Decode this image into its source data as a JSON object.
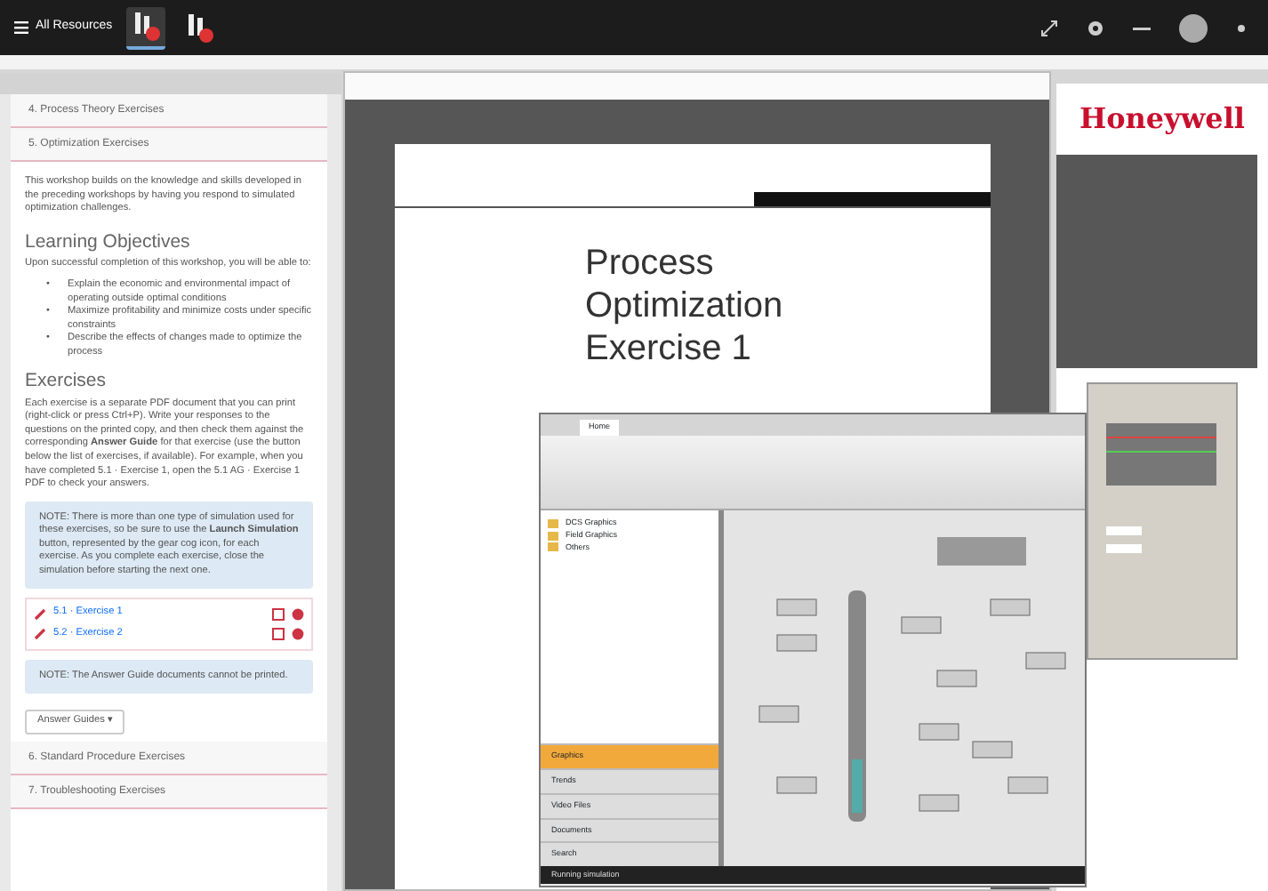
{
  "taskbar": {
    "menu_label": "All Resources",
    "app_icons": [
      {
        "selected": true
      },
      {
        "selected": false
      }
    ]
  },
  "course_panel": {
    "sections": [
      {
        "label": "4. Process Theory Exercises"
      },
      {
        "label": "5. Optimization Exercises"
      }
    ],
    "intro": "This workshop builds on the knowledge and skills developed in the preceding workshops by having you respond to simulated optimization challenges.",
    "objectives_heading": "Learning Objectives",
    "objectives_intro": "Upon successful completion of this workshop, you will be able to:",
    "objectives": [
      {
        "bullet": "•",
        "text": "Explain the economic and environmental impact of operating outside optimal conditions"
      },
      {
        "bullet": "•",
        "text": "Maximize profitability and minimize costs under specific constraints"
      },
      {
        "bullet": "•",
        "text": "Describe the effects of changes made to optimize the process"
      }
    ],
    "exercises_heading": "Exercises",
    "exercises_text": "Each exercise is a separate PDF document that you can print (right-click or press Ctrl+P). Write your responses to the questions on the printed copy, and then check them against the corresponding **Answer Guide** for that exercise (use the button below the list of exercises, if available). For example, when you have completed 5.1 · Exercise 1, open the 5.1 AG · Exercise 1 PDF to check your answers.",
    "note": "NOTE: There is more than one type of simulation used for these exercises, so be sure to use the **Launch Simulation** button, represented by the gear cog icon, for each exercise. As you complete each exercise, close the simulation before starting the next one.",
    "exercise_links": [
      {
        "label": "5.1 · Exercise 1"
      },
      {
        "label": "5.2 · Exercise 2"
      }
    ],
    "answer_note": "NOTE: The Answer Guide documents cannot be printed.",
    "answer_button": "Answer Guides ▾",
    "later_sections": [
      {
        "label": "6. Standard Procedure Exercises"
      },
      {
        "label": "7. Troubleshooting Exercises"
      }
    ]
  },
  "pdf_viewer": {
    "page_title": "Process Optimization Exercise 1"
  },
  "brand_panel": {
    "brand": "Honeywell"
  },
  "simulation": {
    "ribbon_tab": "Home",
    "tree": [
      "DCS Graphics",
      "Field Graphics",
      "Others"
    ],
    "nav": [
      {
        "label": "Graphics",
        "selected": true
      },
      {
        "label": "Trends",
        "selected": false
      },
      {
        "label": "Video Files",
        "selected": false
      },
      {
        "label": "Documents",
        "selected": false
      },
      {
        "label": "Search",
        "selected": false
      }
    ],
    "status": "Running simulation"
  }
}
